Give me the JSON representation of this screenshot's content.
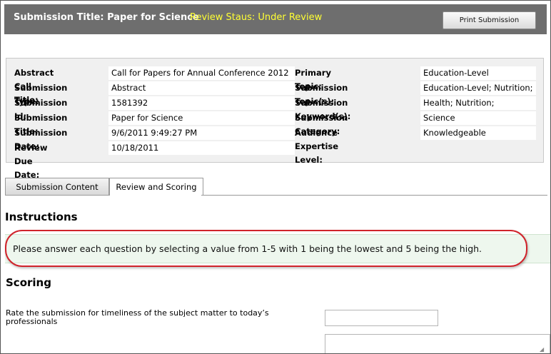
{
  "header": {
    "title": "Submission Title: Paper for Science",
    "status": "Review Staus: Under Review",
    "print_button": "Print Submission"
  },
  "details": {
    "left": [
      {
        "label": "Abstract Call Title:",
        "value": "Call for Papers for Annual Conference 2012"
      },
      {
        "label": "Submission Type:",
        "value": "Abstract"
      },
      {
        "label": "Submission Id:",
        "value": "1581392"
      },
      {
        "label": "Submission Title:",
        "value": "Paper for Science"
      },
      {
        "label": "Submission Date:",
        "value": "9/6/2011 9:49:27 PM"
      },
      {
        "label": "Review Due Date:",
        "value": "10/18/2011"
      }
    ],
    "right": [
      {
        "label": "Primary Topic:",
        "value": "Education-Level"
      },
      {
        "label": "Submission Topic(s):",
        "value": "Education-Level; Nutrition;"
      },
      {
        "label": "Submission Keyword(s):",
        "value": "Health; Nutrition;"
      },
      {
        "label": "Submission Category:",
        "value": "Science"
      },
      {
        "label": "Audience Expertise Level:",
        "value": "Knowledgeable"
      }
    ]
  },
  "tabs": [
    {
      "label": "Submission Content",
      "active": false
    },
    {
      "label": "Review and Scoring",
      "active": true
    }
  ],
  "instructions": {
    "heading": "Instructions",
    "text": "Please answer each question by selecting a value from 1-5 with 1 being the lowest and 5 being the high."
  },
  "scoring": {
    "heading": "Scoring",
    "question": "Rate the submission for timeliness of the subject matter to today’s professionals",
    "answer_value": "",
    "comment_value": ""
  },
  "colors": {
    "header_bg": "#6e6e6e",
    "status_text": "#ffff33",
    "highlight_ring": "#d0232b",
    "instructions_bg": "#eef7ee"
  }
}
